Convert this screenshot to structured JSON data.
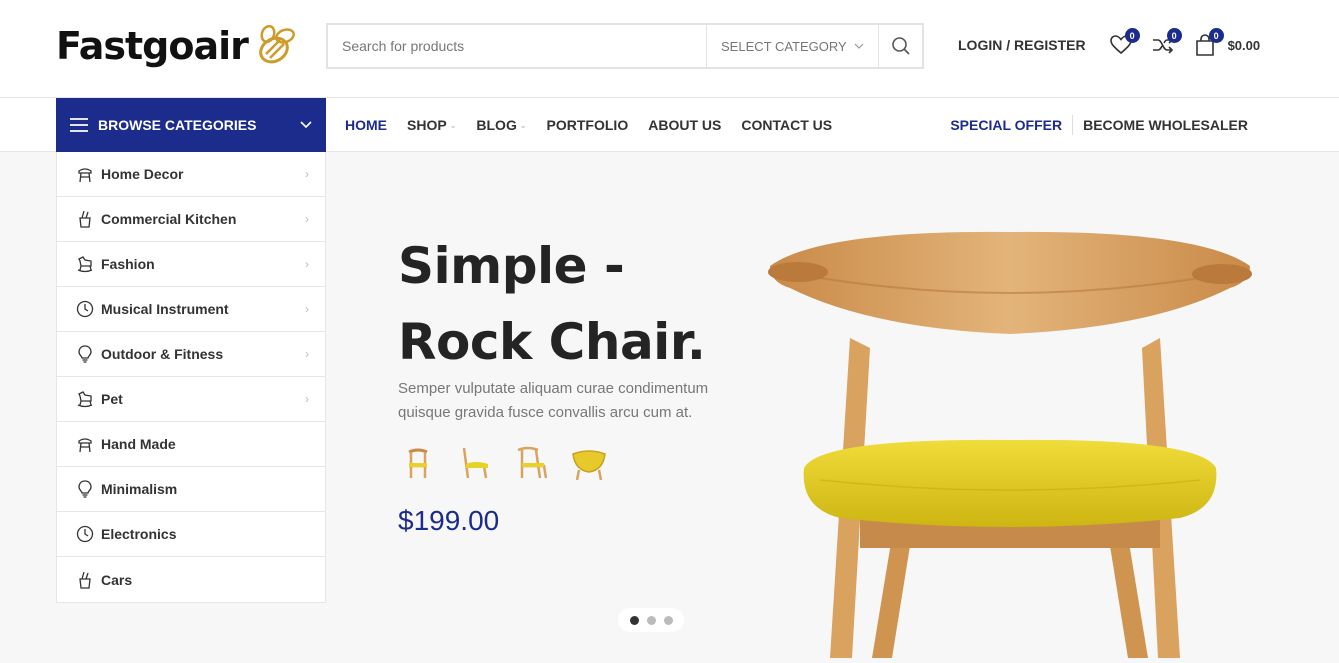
{
  "logo": {
    "text": "Fastgoair",
    "icon": "bee-icon"
  },
  "search": {
    "placeholder": "Search for products",
    "category": "SELECT CATEGORY"
  },
  "header": {
    "login": "LOGIN / REGISTER",
    "wishlist_count": "0",
    "compare_count": "0",
    "cart_count": "0",
    "cart_total": "$0.00"
  },
  "nav": {
    "browse": "BROWSE CATEGORIES",
    "items": [
      {
        "label": "HOME",
        "active": true
      },
      {
        "label": "SHOP"
      },
      {
        "label": "BLOG"
      },
      {
        "label": "PORTFOLIO"
      },
      {
        "label": "ABOUT US"
      },
      {
        "label": "CONTACT US"
      }
    ],
    "special": "SPECIAL OFFER",
    "wholesaler": "BECOME WHOLESALER"
  },
  "categories": [
    {
      "label": "Home Decor",
      "icon": "chair-icon"
    },
    {
      "label": "Commercial Kitchen",
      "icon": "kitchen-icon"
    },
    {
      "label": "Fashion",
      "icon": "rocking-horse-icon"
    },
    {
      "label": "Musical Instrument",
      "icon": "clock-icon"
    },
    {
      "label": "Outdoor & Fitness",
      "icon": "bulb-icon"
    },
    {
      "label": "Pet",
      "icon": "rocking-horse-icon"
    },
    {
      "label": "Hand Made",
      "icon": "chair-icon"
    },
    {
      "label": "Minimalism",
      "icon": "bulb-icon"
    },
    {
      "label": "Electronics",
      "icon": "clock-icon"
    },
    {
      "label": "Cars",
      "icon": "kitchen-icon"
    }
  ],
  "slide": {
    "title": "Simple - Rock Chair.",
    "description": "Semper vulputate aliquam curae condimentum quisque gravida fusce convallis arcu cum at.",
    "price": "$199.00",
    "active_dot": 1,
    "dot_count": 3
  },
  "colors": {
    "accent": "#1b2c8c",
    "seat": "#e8d227",
    "wood": "#d9a25f"
  }
}
